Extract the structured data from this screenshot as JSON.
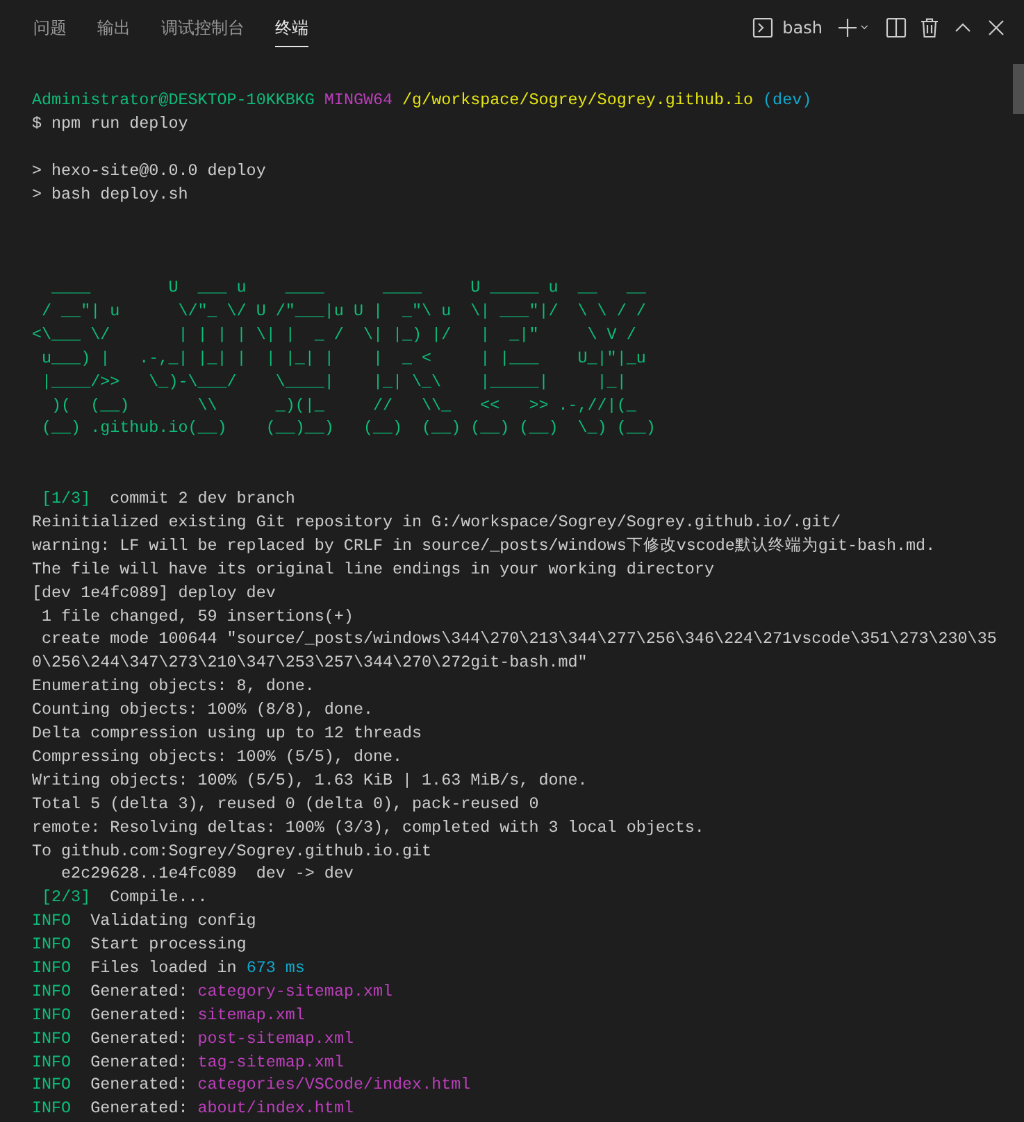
{
  "panel_tabs": [
    {
      "label": "问题",
      "selected": false
    },
    {
      "label": "输出",
      "selected": false
    },
    {
      "label": "调试控制台",
      "selected": false
    },
    {
      "label": "终端",
      "selected": true
    }
  ],
  "terminal_selector": {
    "label": "bash"
  },
  "terminal": {
    "lines": [
      {
        "kind": "text",
        "segments": [
          {
            "text": "Administrator@DESKTOP-10KKBKG ",
            "color": "#0dbc79"
          },
          {
            "text": "MINGW64 ",
            "color": "#bc3fbc"
          },
          {
            "text": "/g/workspace/Sogrey/Sogrey.github.io ",
            "color": "#e5e510"
          },
          {
            "text": "(dev)",
            "color": "#11a8cd"
          }
        ]
      },
      {
        "kind": "text",
        "segments": [
          {
            "text": "$ npm run deploy",
            "color": "#cccccc"
          }
        ]
      },
      {
        "kind": "blank"
      },
      {
        "kind": "text",
        "segments": [
          {
            "text": "> hexo-site@0.0.0 deploy",
            "color": "#cccccc"
          }
        ]
      },
      {
        "kind": "text",
        "segments": [
          {
            "text": "> bash deploy.sh",
            "color": "#cccccc"
          }
        ]
      },
      {
        "kind": "blank"
      },
      {
        "kind": "blank"
      },
      {
        "kind": "blank"
      },
      {
        "kind": "art",
        "segments": [
          {
            "text": "  ____        U  ___ u    ____      ____     U _____ u  __   __",
            "color": "#0dbc79"
          }
        ]
      },
      {
        "kind": "art",
        "segments": [
          {
            "text": " / __\"| u      \\/\"_ \\/ U /\"___|u U |  _\"\\ u  \\| ___\"|/  \\ \\ / /",
            "color": "#0dbc79"
          }
        ]
      },
      {
        "kind": "art",
        "segments": [
          {
            "text": "<\\___ \\/       | | | | \\| |  _ /  \\| |_) |/   |  _|\"     \\ V /",
            "color": "#0dbc79"
          }
        ]
      },
      {
        "kind": "art",
        "segments": [
          {
            "text": " u___) |   .-,_| |_| |  | |_| |    |  _ <     | |___    U_|\"|_u",
            "color": "#0dbc79"
          }
        ]
      },
      {
        "kind": "art",
        "segments": [
          {
            "text": " |____/>>   \\_)-\\___/    \\____|    |_| \\_\\    |_____|     |_|",
            "color": "#0dbc79"
          }
        ]
      },
      {
        "kind": "art",
        "segments": [
          {
            "text": "  )(  (__)       \\\\      _)(|_     //   \\\\_   <<   >> .-,//|(_",
            "color": "#0dbc79"
          }
        ]
      },
      {
        "kind": "art",
        "segments": [
          {
            "text": " (__) .github.io(__)    (__)__)   (__)  (__) (__) (__)  \\_) (__)",
            "color": "#0dbc79"
          }
        ]
      },
      {
        "kind": "blank"
      },
      {
        "kind": "blank"
      },
      {
        "kind": "text",
        "segments": [
          {
            "text": " [1/3]",
            "color": "#0dbc79"
          },
          {
            "text": "  commit 2 dev branch",
            "color": "#cccccc"
          }
        ]
      },
      {
        "kind": "text",
        "segments": [
          {
            "text": "Reinitialized existing Git repository in G:/workspace/Sogrey/Sogrey.github.io/.git/",
            "color": "#cccccc"
          }
        ]
      },
      {
        "kind": "text",
        "segments": [
          {
            "text": "warning: LF will be replaced by CRLF in source/_posts/windows下修改vscode默认终端为git-bash.md.",
            "color": "#cccccc"
          }
        ]
      },
      {
        "kind": "text",
        "segments": [
          {
            "text": "The file will have its original line endings in your working directory",
            "color": "#cccccc"
          }
        ]
      },
      {
        "kind": "text",
        "segments": [
          {
            "text": "[dev 1e4fc089] deploy dev",
            "color": "#cccccc"
          }
        ]
      },
      {
        "kind": "text",
        "segments": [
          {
            "text": " 1 file changed, 59 insertions(+)",
            "color": "#cccccc"
          }
        ]
      },
      {
        "kind": "text",
        "segments": [
          {
            "text": " create mode 100644 \"source/_posts/windows\\344\\270\\213\\344\\277\\256\\346\\224\\271vscode\\351\\273\\230\\35",
            "color": "#cccccc"
          }
        ]
      },
      {
        "kind": "text",
        "segments": [
          {
            "text": "0\\256\\244\\347\\273\\210\\347\\253\\257\\344\\270\\272git-bash.md\"",
            "color": "#cccccc"
          }
        ]
      },
      {
        "kind": "text",
        "segments": [
          {
            "text": "Enumerating objects: 8, done.",
            "color": "#cccccc"
          }
        ]
      },
      {
        "kind": "text",
        "segments": [
          {
            "text": "Counting objects: 100% (8/8), done.",
            "color": "#cccccc"
          }
        ]
      },
      {
        "kind": "text",
        "segments": [
          {
            "text": "Delta compression using up to 12 threads",
            "color": "#cccccc"
          }
        ]
      },
      {
        "kind": "text",
        "segments": [
          {
            "text": "Compressing objects: 100% (5/5), done.",
            "color": "#cccccc"
          }
        ]
      },
      {
        "kind": "text",
        "segments": [
          {
            "text": "Writing objects: 100% (5/5), 1.63 KiB | 1.63 MiB/s, done.",
            "color": "#cccccc"
          }
        ]
      },
      {
        "kind": "text",
        "segments": [
          {
            "text": "Total 5 (delta 3), reused 0 (delta 0), pack-reused 0",
            "color": "#cccccc"
          }
        ]
      },
      {
        "kind": "text",
        "segments": [
          {
            "text": "remote: Resolving deltas: 100% (3/3), completed with 3 local objects.",
            "color": "#cccccc"
          }
        ]
      },
      {
        "kind": "text",
        "segments": [
          {
            "text": "To github.com:Sogrey/Sogrey.github.io.git",
            "color": "#cccccc"
          }
        ]
      },
      {
        "kind": "text",
        "segments": [
          {
            "text": "   e2c29628..1e4fc089  dev -> dev",
            "color": "#cccccc"
          }
        ]
      },
      {
        "kind": "text",
        "segments": [
          {
            "text": " [2/3]",
            "color": "#0dbc79"
          },
          {
            "text": "  Compile...",
            "color": "#cccccc"
          }
        ]
      },
      {
        "kind": "text",
        "segments": [
          {
            "text": "INFO",
            "color": "#0dbc79"
          },
          {
            "text": "  Validating config",
            "color": "#cccccc"
          }
        ]
      },
      {
        "kind": "text",
        "segments": [
          {
            "text": "INFO",
            "color": "#0dbc79"
          },
          {
            "text": "  Start processing",
            "color": "#cccccc"
          }
        ]
      },
      {
        "kind": "text",
        "segments": [
          {
            "text": "INFO",
            "color": "#0dbc79"
          },
          {
            "text": "  Files loaded in ",
            "color": "#cccccc"
          },
          {
            "text": "673 ms",
            "color": "#11a8cd"
          }
        ]
      },
      {
        "kind": "text",
        "segments": [
          {
            "text": "INFO",
            "color": "#0dbc79"
          },
          {
            "text": "  Generated: ",
            "color": "#cccccc"
          },
          {
            "text": "category-sitemap.xml",
            "color": "#bc3fbc"
          }
        ]
      },
      {
        "kind": "text",
        "segments": [
          {
            "text": "INFO",
            "color": "#0dbc79"
          },
          {
            "text": "  Generated: ",
            "color": "#cccccc"
          },
          {
            "text": "sitemap.xml",
            "color": "#bc3fbc"
          }
        ]
      },
      {
        "kind": "text",
        "segments": [
          {
            "text": "INFO",
            "color": "#0dbc79"
          },
          {
            "text": "  Generated: ",
            "color": "#cccccc"
          },
          {
            "text": "post-sitemap.xml",
            "color": "#bc3fbc"
          }
        ]
      },
      {
        "kind": "text",
        "segments": [
          {
            "text": "INFO",
            "color": "#0dbc79"
          },
          {
            "text": "  Generated: ",
            "color": "#cccccc"
          },
          {
            "text": "tag-sitemap.xml",
            "color": "#bc3fbc"
          }
        ]
      },
      {
        "kind": "text",
        "segments": [
          {
            "text": "INFO",
            "color": "#0dbc79"
          },
          {
            "text": "  Generated: ",
            "color": "#cccccc"
          },
          {
            "text": "categories/VSCode/index.html",
            "color": "#bc3fbc"
          }
        ]
      },
      {
        "kind": "text",
        "segments": [
          {
            "text": "INFO",
            "color": "#0dbc79"
          },
          {
            "text": "  Generated: ",
            "color": "#cccccc"
          },
          {
            "text": "about/index.html",
            "color": "#bc3fbc"
          }
        ]
      }
    ]
  }
}
